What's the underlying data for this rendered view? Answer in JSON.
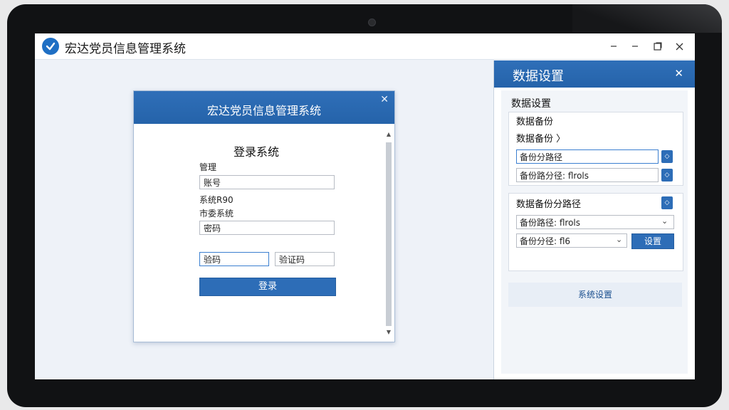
{
  "window": {
    "title": "宏达党员信息管理系统",
    "controls": {
      "minimize": "–",
      "restore": "⎯",
      "maximize": "◰",
      "close": "✕"
    }
  },
  "login_dialog": {
    "title": "宏达党员信息管理系统",
    "close": "✕",
    "heading": "登录系统",
    "label_1": "管理",
    "field_1_value": "账号",
    "label_2": "系统R90",
    "label_3": "市委系统",
    "field_2_value": "密码",
    "field_3_value": "验码",
    "field_4_value": "验证码",
    "login_button": "登录",
    "scroll_up": "▲",
    "scroll_down": "▼"
  },
  "data_panel": {
    "title": "数据设置",
    "close": "✕",
    "section_title": "数据设置",
    "backup": {
      "title": "数据备份",
      "subtitle": "数据备份 〉",
      "row_1_value": "备份分路径",
      "row_2_value": "备份路分径: flrols"
    },
    "restore": {
      "title": "数据备份分路径",
      "row_1_value": "备份路径: flrols",
      "row_2_value": "备份分径: fl6",
      "apply_button": "设置",
      "dropdown_arrow": "⌄"
    },
    "system_settings_button": "系统设置"
  },
  "colors": {
    "accent": "#2d6db7",
    "header": "#2563aa",
    "screen_bg": "#eef2f8"
  },
  "icons": {
    "app_logo": "check-circle-icon",
    "spin": "spinner-arrows-icon"
  }
}
